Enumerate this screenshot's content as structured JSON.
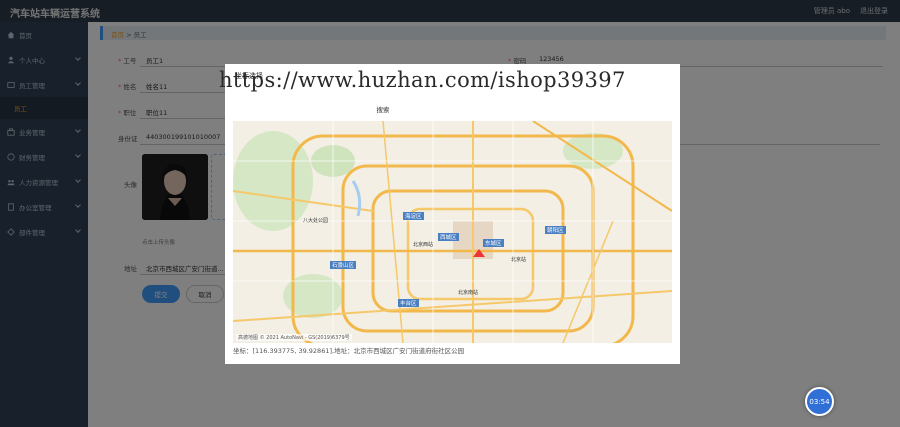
{
  "app": {
    "title": "汽车站车辆运营系统"
  },
  "header": {
    "admin_label": "管理员 abo",
    "logout_label": "退出登录"
  },
  "sidebar": {
    "items": [
      {
        "label": "首页",
        "icon": "home-icon"
      },
      {
        "label": "个人中心",
        "icon": "user-icon"
      },
      {
        "label": "员工管理",
        "icon": "staff-icon"
      },
      {
        "label": "业务管理",
        "icon": "business-icon"
      },
      {
        "label": "财务管理",
        "icon": "finance-icon"
      },
      {
        "label": "人力资源管理",
        "icon": "hr-icon"
      },
      {
        "label": "办公室管理",
        "icon": "office-icon"
      },
      {
        "label": "部件管理",
        "icon": "parts-icon"
      }
    ],
    "active_sub": "员工"
  },
  "breadcrumb": {
    "home": "首页",
    "separator": ">",
    "current": "员工"
  },
  "form": {
    "job_no_label": "工号",
    "job_no_value": "员工1",
    "password_label": "密码",
    "password_value": "123456",
    "name_label": "姓名",
    "name_value": "姓名11",
    "position_label": "职位",
    "position_value": "职位11",
    "id_card_label": "身份证",
    "id_card_value": "440300199101010007",
    "avatar_label": "头像",
    "upload_hint": "点击上传头像",
    "address_label": "地址",
    "address_value": "北京市西城区广安门街道...",
    "submit_label": "提交",
    "cancel_label": "取消"
  },
  "modal": {
    "title": "坐标选择",
    "watermark": "https://www.huzhan.com/ishop39397",
    "search_label": "搜索",
    "map_copyright": "高德地图 © 2021 AutoNavi - GS(2019)6379号",
    "coord_text": "坐标：[116.393775, 39.92861],地址：北京市西城区广安门街道府街社区公园",
    "map_labels": [
      "海淀区",
      "西城区",
      "东城区",
      "朝阳区",
      "丰台区",
      "石景山区",
      "北京西站",
      "北京站",
      "八大处公园",
      "北京南站"
    ]
  },
  "timer": {
    "value": "03:54"
  },
  "colors": {
    "accent": "#409eff",
    "sidebar_bg": "#304156",
    "topbar_bg": "#2d3a4b",
    "active": "#f4a032"
  }
}
